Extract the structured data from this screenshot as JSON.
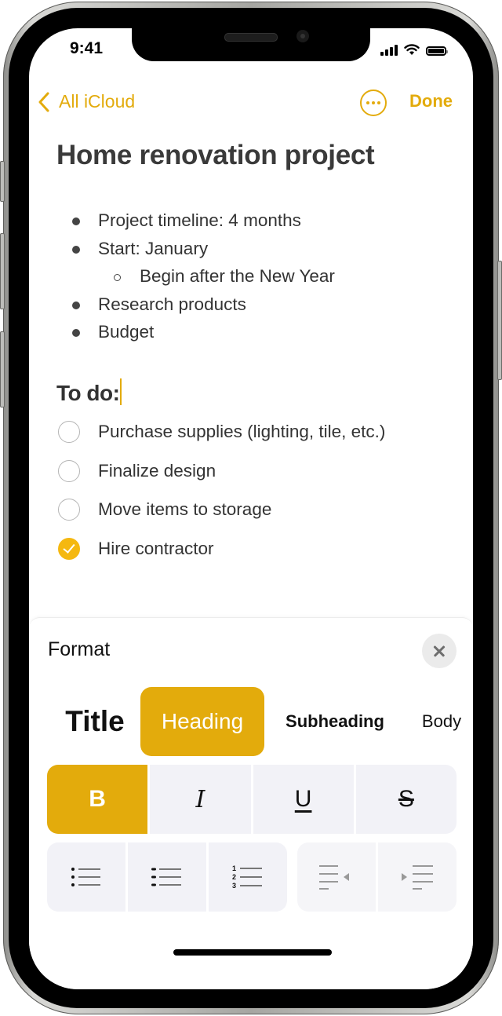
{
  "status_bar": {
    "time": "9:41",
    "signal_icon": "cellular-signal-icon",
    "wifi_icon": "wifi-icon",
    "battery_icon": "battery-icon"
  },
  "nav": {
    "back_label": "All iCloud",
    "back_icon": "chevron-left-icon",
    "more_icon": "ellipsis-circle-icon",
    "done_label": "Done"
  },
  "note": {
    "title": "Home renovation project",
    "bullets": [
      {
        "text": "Project timeline: 4 months",
        "level": 1
      },
      {
        "text": "Start: January",
        "level": 1
      },
      {
        "text": "Begin after the New Year",
        "level": 2
      },
      {
        "text": "Research products",
        "level": 1
      },
      {
        "text": "Budget",
        "level": 1
      }
    ],
    "todo_heading": "To do:",
    "checklist": [
      {
        "text": "Purchase supplies (lighting, tile, etc.)",
        "checked": false
      },
      {
        "text": "Finalize design",
        "checked": false
      },
      {
        "text": "Move items to storage",
        "checked": false
      },
      {
        "text": "Hire contractor",
        "checked": true
      }
    ]
  },
  "format_panel": {
    "title": "Format",
    "close_icon": "close-icon",
    "styles": [
      "Title",
      "Heading",
      "Subheading",
      "Body"
    ],
    "selected_style": "Heading",
    "text_styles": {
      "bold": "B",
      "italic": "I",
      "underline": "U",
      "strikethrough": "S"
    },
    "bold_active": true,
    "list_buttons": [
      "bulleted-list-icon",
      "dashed-list-icon",
      "numbered-list-icon"
    ],
    "indent_buttons": [
      "outdent-icon",
      "indent-icon"
    ]
  },
  "colors": {
    "accent": "#e3ab0c",
    "checkbox_checked": "#f5b810",
    "segment_bg": "#f2f2f7",
    "text": "#333333"
  }
}
